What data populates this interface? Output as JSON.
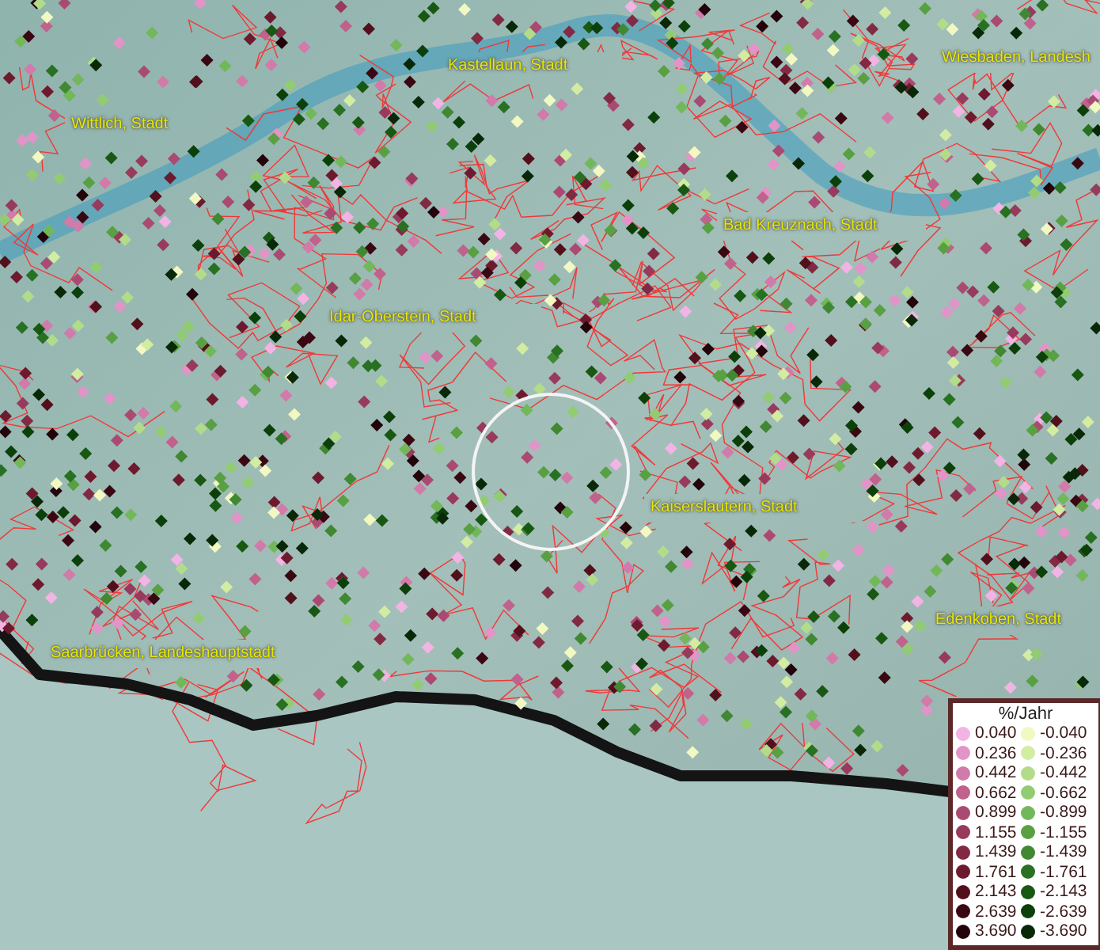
{
  "map": {
    "places": [
      {
        "name": "Kastellaun, Stadt"
      },
      {
        "name": "Wiesbaden, Landesh"
      },
      {
        "name": "Wittlich, Stadt"
      },
      {
        "name": "Bad Kreuznach, Stadt"
      },
      {
        "name": "Idar-Oberstein, Stadt"
      },
      {
        "name": "Kaiserslautern, Stadt"
      },
      {
        "name": "Edenkoben, Stadt"
      },
      {
        "name": "Saarbrücken, Landeshauptstadt"
      }
    ]
  },
  "legend": {
    "title": "%/Jahr",
    "increase": [
      {
        "value": "0.040",
        "color": "#f2b4e4"
      },
      {
        "value": "0.236",
        "color": "#e294c8"
      },
      {
        "value": "0.442",
        "color": "#d27aaa"
      },
      {
        "value": "0.662",
        "color": "#c0628c"
      },
      {
        "value": "0.899",
        "color": "#aa4a72"
      },
      {
        "value": "1.155",
        "color": "#983a5c"
      },
      {
        "value": "1.439",
        "color": "#822a44"
      },
      {
        "value": "1.761",
        "color": "#6e1a2e"
      },
      {
        "value": "2.143",
        "color": "#52101c"
      },
      {
        "value": "2.639",
        "color": "#3a0812"
      },
      {
        "value": "3.690",
        "color": "#22040a"
      }
    ],
    "decrease": [
      {
        "value": "-0.040",
        "color": "#f2f8c2"
      },
      {
        "value": "-0.236",
        "color": "#d2eca2"
      },
      {
        "value": "-0.442",
        "color": "#b2dc8a"
      },
      {
        "value": "-0.662",
        "color": "#92cc72"
      },
      {
        "value": "-0.899",
        "color": "#72b85a"
      },
      {
        "value": "-1.155",
        "color": "#58a042"
      },
      {
        "value": "-1.439",
        "color": "#408832"
      },
      {
        "value": "-1.761",
        "color": "#287022"
      },
      {
        "value": "-2.143",
        "color": "#185812"
      },
      {
        "value": "-2.639",
        "color": "#0c400a"
      },
      {
        "value": "-3.690",
        "color": "#082808"
      }
    ]
  }
}
